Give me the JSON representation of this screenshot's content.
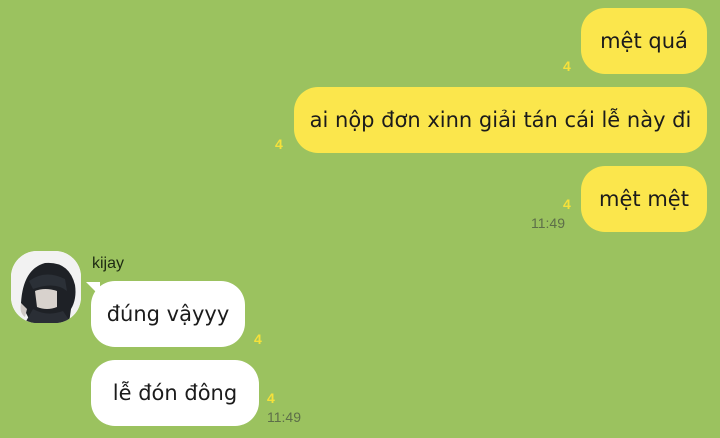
{
  "messages": {
    "outgoing": [
      {
        "text": "mệt quá",
        "unread": "4"
      },
      {
        "text": "ai nộp đơn xinn giải tán cái lễ này đi",
        "unread": "4"
      },
      {
        "text": "mệt mệt",
        "unread": "4",
        "time": "11:49"
      }
    ],
    "incoming": {
      "sender": "kijay",
      "items": [
        {
          "text": "đúng vậyyy",
          "unread": "4"
        },
        {
          "text": "lễ đón đông",
          "unread": "4",
          "time": "11:49"
        }
      ]
    }
  },
  "colors": {
    "background": "#9bc25f",
    "outgoing_bubble": "#fbe64c",
    "incoming_bubble": "#ffffff",
    "unread_badge": "#f6e13a"
  }
}
